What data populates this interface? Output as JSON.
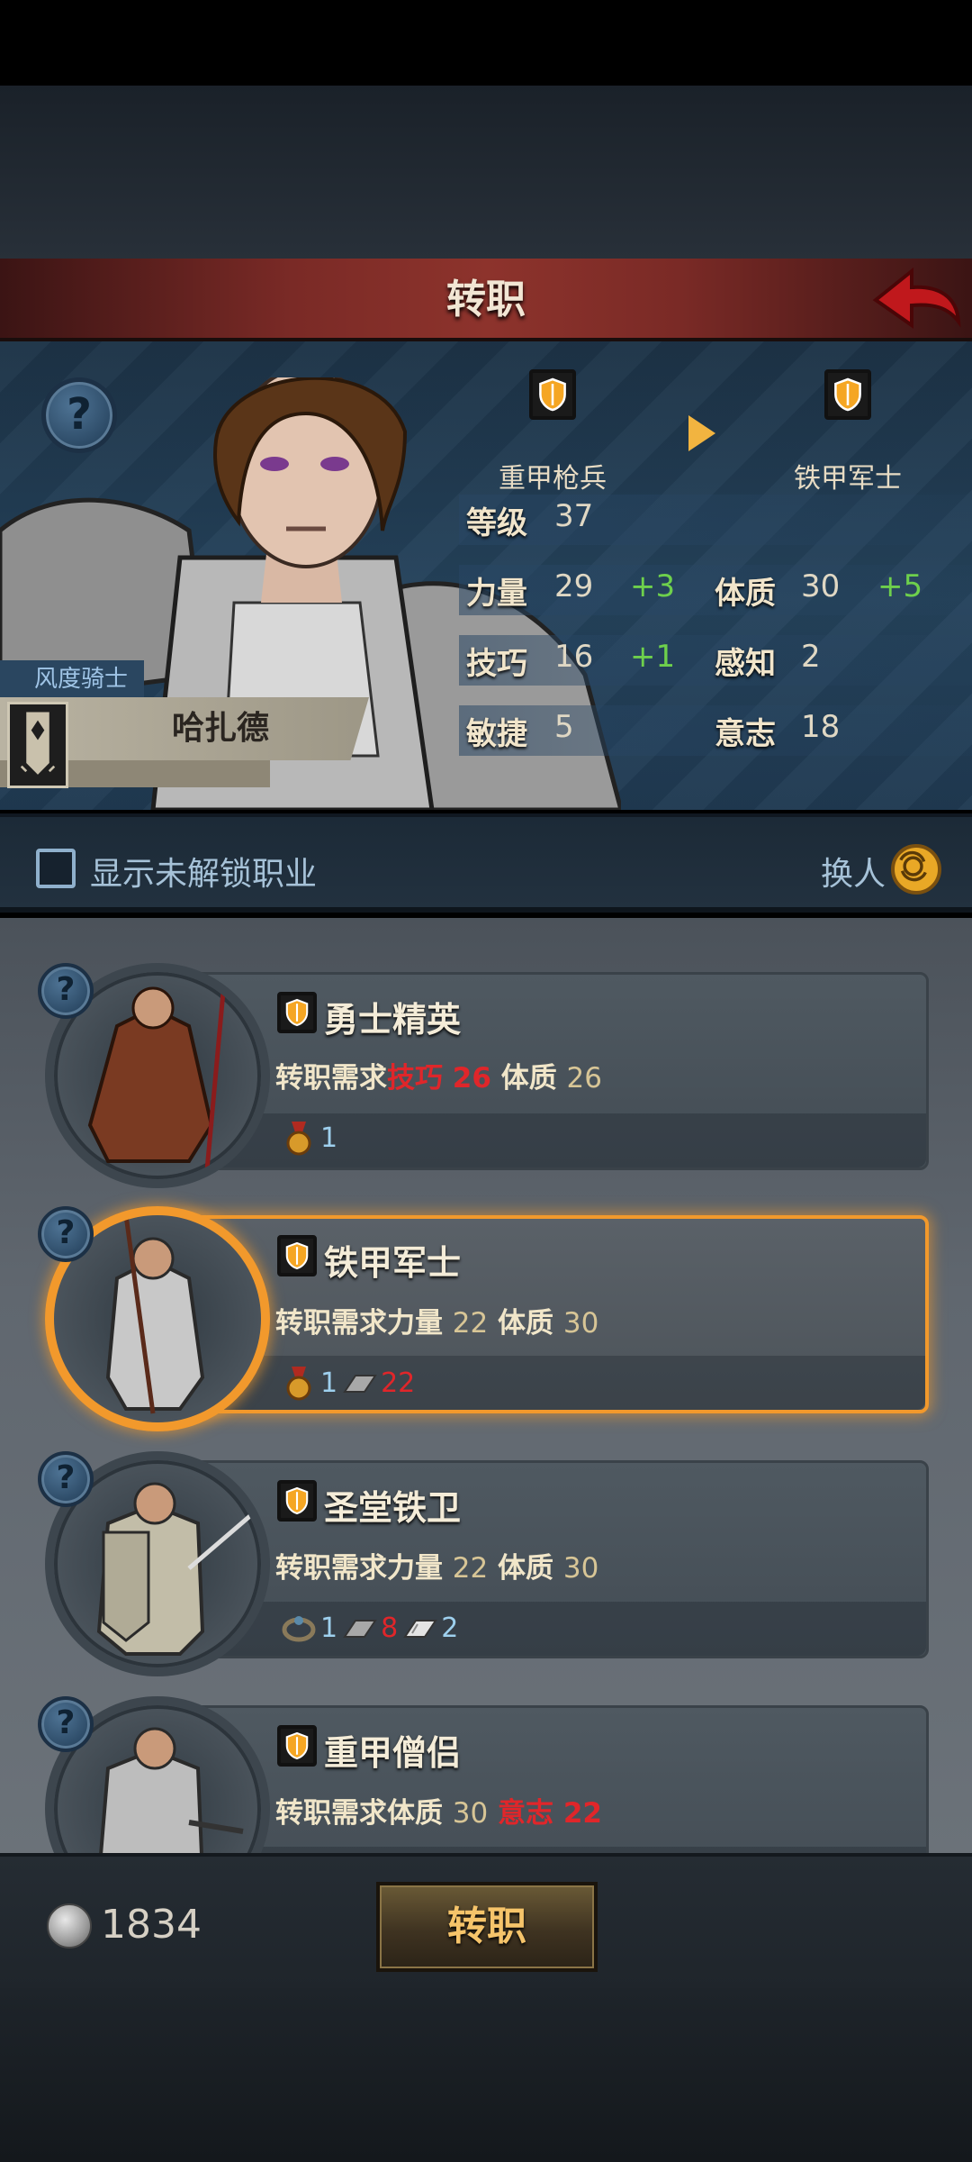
{
  "header": {
    "title": "转职"
  },
  "hero": {
    "subclass": "风度骑士",
    "name": "哈扎德",
    "current_class": "重甲枪兵",
    "target_class": "铁甲军士",
    "stats": {
      "level_label": "等级",
      "level": "37",
      "str_label": "力量",
      "str": "29",
      "str_bonus": "+3",
      "con_label": "体质",
      "con": "30",
      "con_bonus": "+5",
      "skill_label": "技巧",
      "skill": "16",
      "skill_bonus": "+1",
      "per_label": "感知",
      "per": "2",
      "agi_label": "敏捷",
      "agi": "5",
      "will_label": "意志",
      "will": "18"
    }
  },
  "filter": {
    "show_locked_label": "显示未解锁职业",
    "swap_label": "换人"
  },
  "jobs": [
    {
      "title": "勇士精英",
      "req_prefix": "转职需求",
      "req1_label": "技巧",
      "req1_val": "26",
      "req2_label": "体质",
      "req2_val": "26",
      "items": [
        {
          "icon": "medal-icon",
          "count": "1"
        }
      ]
    },
    {
      "title": "铁甲军士",
      "req_prefix": "转职需求",
      "req1_label": "力量",
      "req1_val": "22",
      "req2_label": "体质",
      "req2_val": "30",
      "items": [
        {
          "icon": "medal-icon",
          "count": "1"
        },
        {
          "icon": "iron-ingot-icon",
          "count": "22"
        }
      ]
    },
    {
      "title": "圣堂铁卫",
      "req_prefix": "转职需求",
      "req1_label": "力量",
      "req1_val": "22",
      "req2_label": "体质",
      "req2_val": "30",
      "items": [
        {
          "icon": "ring-icon",
          "count": "1"
        },
        {
          "icon": "iron-ingot-icon",
          "count": "8"
        },
        {
          "icon": "steel-ingot-icon",
          "count": "2"
        }
      ]
    },
    {
      "title": "重甲僧侣",
      "req_prefix": "转职需求",
      "req1_label": "体质",
      "req1_val": "30",
      "req2_label": "意志",
      "req2_val": "22",
      "items": []
    }
  ],
  "footer": {
    "currency": "1834",
    "confirm_label": "转职"
  },
  "colors": {
    "accent_orange": "#f2992c",
    "bonus_green": "#6ed04c",
    "warning_red": "#e0262a"
  }
}
